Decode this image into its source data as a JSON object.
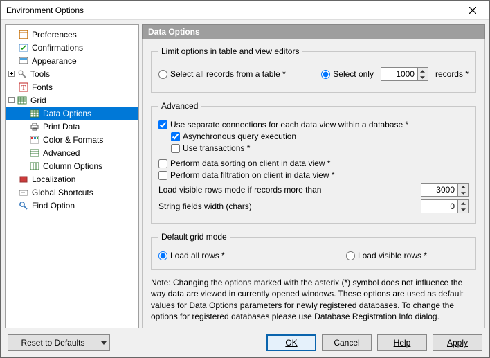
{
  "window": {
    "title": "Environment Options"
  },
  "tree": {
    "preferences": "Preferences",
    "confirmations": "Confirmations",
    "appearance": "Appearance",
    "tools": "Tools",
    "fonts": "Fonts",
    "grid": "Grid",
    "data_options": "Data Options",
    "print_data": "Print Data",
    "color_formats": "Color & Formats",
    "advanced": "Advanced",
    "column_options": "Column Options",
    "localization": "Localization",
    "global_shortcuts": "Global Shortcuts",
    "find_option": "Find Option"
  },
  "header": {
    "title": "Data Options"
  },
  "limit": {
    "legend": "Limit options in table and view editors",
    "select_all": "Select all records from a table *",
    "select_only": "Select only",
    "value": "1000",
    "records": "records *"
  },
  "adv": {
    "legend": "Advanced",
    "use_sep_conn": "Use separate connections for each data view within a database *",
    "async": "Asynchronous query execution",
    "use_txn": "Use transactions *",
    "sort_client": "Perform data sorting on client in data view *",
    "filter_client": "Perform data filtration on client in data view *",
    "load_rows_label": "Load visible rows mode if records more than",
    "load_rows_value": "3000",
    "string_width_label": "String fields width (chars)",
    "string_width_value": "0"
  },
  "gridmode": {
    "legend": "Default grid mode",
    "load_all": "Load all rows *",
    "load_visible": "Load visible rows *"
  },
  "note": "Note: Changing the options marked with the asterix (*) symbol does not influence the way data are viewed in currently opened windows. These options are used as default values for Data Options parameters for newly registered databases. To change the options for registered databases please use Database Registration Info dialog.",
  "footer": {
    "reset": "Reset to Defaults",
    "ok": "OK",
    "cancel": "Cancel",
    "help": "Help",
    "apply": "Apply"
  }
}
